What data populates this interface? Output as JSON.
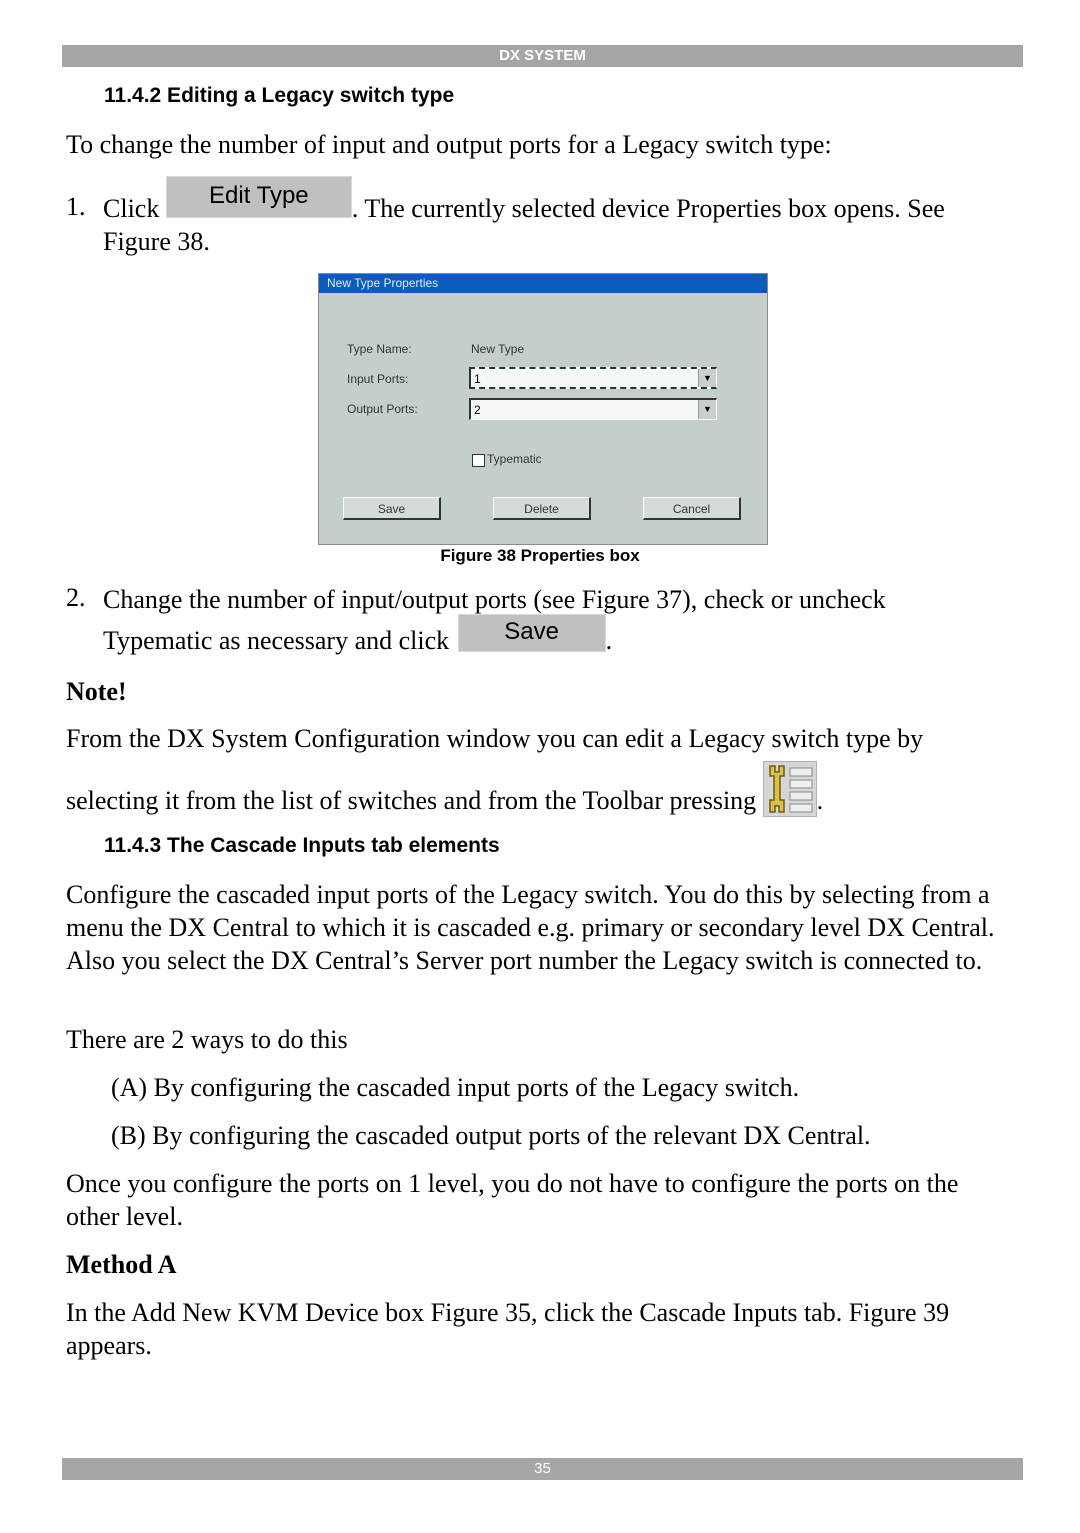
{
  "header": {
    "title": "DX SYSTEM"
  },
  "footer": {
    "page_number": "35"
  },
  "section_1": {
    "heading": "11.4.2 Editing a Legacy switch type",
    "intro": "To change the number of input and output ports for a Legacy switch type:",
    "step1": {
      "number": "1.",
      "prefix": "Click",
      "button_label": "Edit Type",
      "suffix": ". The currently selected device Properties box opens. See",
      "continuation": "Figure 38."
    },
    "figure": {
      "dialog_title": "New Type Properties",
      "type_name_label": "Type Name:",
      "type_name_value": "New Type",
      "input_ports_label": "Input Ports:",
      "input_ports_value": "1",
      "output_ports_label": "Output Ports:",
      "output_ports_value": "2",
      "typematic_label": "Typematic",
      "typematic_checked": false,
      "save_label": "Save",
      "delete_label": "Delete",
      "cancel_label": "Cancel",
      "caption": "Figure 38 Properties box"
    },
    "step2": {
      "number": "2.",
      "line1": "Change the number of input/output ports (see Figure 37), check or uncheck",
      "line2_prefix": "Typematic as necessary and click",
      "button_label": "Save",
      "line2_suffix": "."
    },
    "note": {
      "heading": "Note!",
      "line1": "From the DX System Configuration window you can edit a Legacy switch type by",
      "line2_prefix": "selecting it from the list of switches and from the Toolbar pressing",
      "icon": "edit-switch-type-toolbar-icon",
      "line2_suffix": "."
    }
  },
  "section_2": {
    "heading": "11.4.3 The Cascade Inputs tab elements",
    "paragraph1": "Configure the cascaded input ports of the Legacy switch. You do this by selecting from a menu the DX Central to which it is cascaded e.g. primary or secondary level DX Central. Also you select the DX Central’s Server port number the Legacy switch is connected to.",
    "paragraph2": "There are 2 ways to do this",
    "option_a": "(A) By configuring the cascaded input ports of the Legacy switch.",
    "option_b": "(B) By configuring the cascaded output ports of the relevant DX Central.",
    "paragraph3": "Once you configure the ports on 1 level, you do not have to configure the ports on the other level.",
    "method_heading": "Method A",
    "paragraph4": "In the Add New KVM Device box Figure 35, click the Cascade Inputs tab. Figure 39 appears."
  }
}
